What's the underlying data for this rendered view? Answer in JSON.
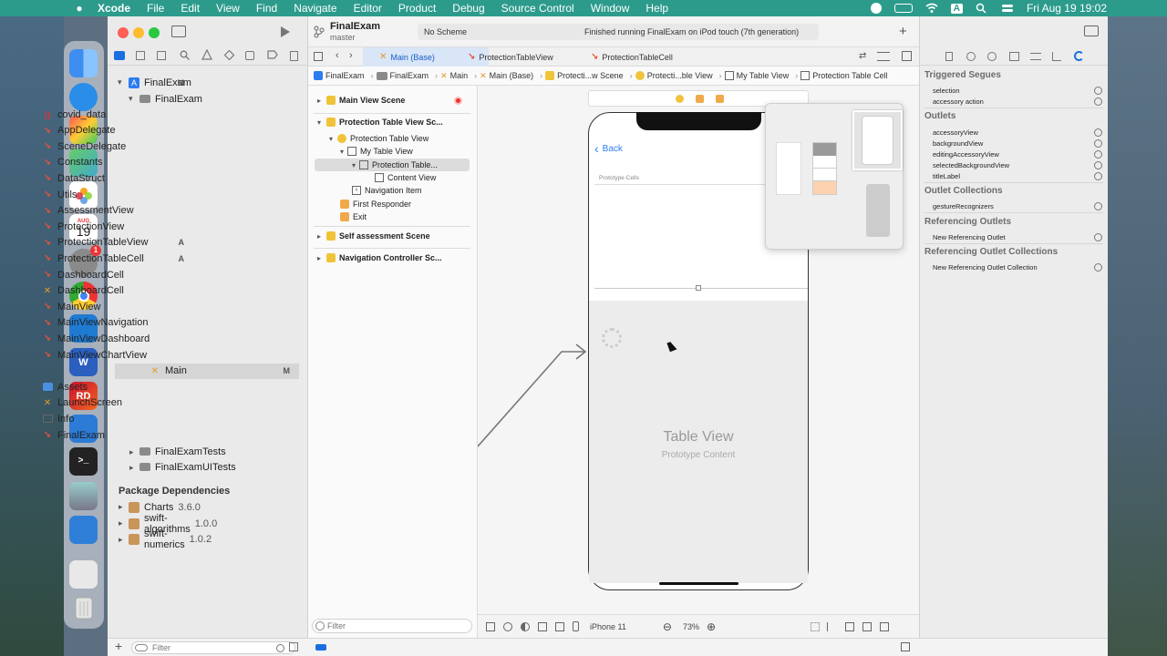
{
  "menubar": {
    "app": "Xcode",
    "items": [
      "File",
      "Edit",
      "View",
      "Find",
      "Navigate",
      "Editor",
      "Product",
      "Debug",
      "Source Control",
      "Window",
      "Help"
    ],
    "input_source": "A",
    "clock": "Fri Aug 19  19:02"
  },
  "dock": {
    "calendar_month": "AUG",
    "calendar_day": "19",
    "settings_badge": "1",
    "rider_label": "RD",
    "word_label": "W"
  },
  "toolbar": {
    "project": "FinalExam",
    "branch": "master",
    "scheme": "No Scheme",
    "status": "Finished running FinalExam on iPod touch (7th generation)",
    "add": "+"
  },
  "navigator": {
    "project_root": "FinalExam",
    "project_root_badge": "M",
    "group": "FinalExam",
    "files": [
      {
        "name": "covid_data",
        "kind": "json",
        "badge": ""
      },
      {
        "name": "AppDelegate",
        "kind": "swift",
        "badge": ""
      },
      {
        "name": "SceneDelegate",
        "kind": "swift",
        "badge": ""
      },
      {
        "name": "Constants",
        "kind": "swift",
        "badge": ""
      },
      {
        "name": "DataStruct",
        "kind": "swift",
        "badge": ""
      },
      {
        "name": "Utils",
        "kind": "swift",
        "badge": ""
      },
      {
        "name": "AssessmentView",
        "kind": "swift",
        "badge": ""
      },
      {
        "name": "ProtectionView",
        "kind": "swift",
        "badge": ""
      },
      {
        "name": "ProtectionTableView",
        "kind": "swift",
        "badge": "A"
      },
      {
        "name": "ProtectionTableCell",
        "kind": "swift",
        "badge": "A"
      },
      {
        "name": "DashboardCell",
        "kind": "swift",
        "badge": ""
      },
      {
        "name": "DashboardCell",
        "kind": "xib",
        "badge": ""
      },
      {
        "name": "MainView",
        "kind": "swift",
        "badge": ""
      },
      {
        "name": "MainViewNavigation",
        "kind": "swift",
        "badge": ""
      },
      {
        "name": "MainViewDashboard",
        "kind": "swift",
        "badge": ""
      },
      {
        "name": "MainViewChartView",
        "kind": "swift",
        "badge": ""
      },
      {
        "name": "Main",
        "kind": "storyboard",
        "badge": "M"
      },
      {
        "name": "Assets",
        "kind": "assets",
        "badge": ""
      },
      {
        "name": "LaunchScreen",
        "kind": "storyboard",
        "badge": ""
      },
      {
        "name": "Info",
        "kind": "plist",
        "badge": ""
      },
      {
        "name": "FinalExam",
        "kind": "swift",
        "badge": ""
      }
    ],
    "groups": [
      "FinalExamTests",
      "FinalExamUITests"
    ],
    "package_header": "Package Dependencies",
    "packages": [
      {
        "name": "Charts",
        "version": "3.6.0"
      },
      {
        "name": "swift-algorithms",
        "version": "1.0.0"
      },
      {
        "name": "swift-numerics",
        "version": "1.0.2"
      }
    ],
    "filter_placeholder": "Filter"
  },
  "tabs": [
    {
      "label": "Main (Base)"
    },
    {
      "label": "ProtectionTableView"
    },
    {
      "label": "ProtectionTableCell"
    }
  ],
  "jumpbar": [
    "FinalExam",
    "FinalExam",
    "Main",
    "Main (Base)",
    "Protecti...w Scene",
    "Protecti...ble View",
    "My Table View",
    "Protection Table Cell"
  ],
  "outline": {
    "main_scene": "Main View Scene",
    "protection_scene": "Protection Table View Sc...",
    "protection_controller": "Protection Table View",
    "my_table_view": "My Table View",
    "cell": "Protection Table...",
    "content_view": "Content View",
    "navigation_item": "Navigation Item",
    "first_responder": "First Responder",
    "exit": "Exit",
    "self_assessment": "Self assessment Scene",
    "nav_controller": "Navigation Controller Sc...",
    "filter_placeholder": "Filter"
  },
  "canvas": {
    "back": "Back",
    "prototype_cells": "Prototype Cells",
    "table_view_title": "Table View",
    "table_view_sub": "Prototype Content",
    "device": "iPhone 11",
    "zoom": "73%"
  },
  "inspector": {
    "triggered_segues": "Triggered Segues",
    "segues": [
      "selection",
      "accessory action"
    ],
    "outlets": "Outlets",
    "outlet_items": [
      "accessoryView",
      "backgroundView",
      "editingAccessoryView",
      "selectedBackgroundView",
      "titleLabel"
    ],
    "outlet_collections": "Outlet Collections",
    "collection_items": [
      "gestureRecognizers"
    ],
    "referencing_outlets": "Referencing Outlets",
    "referencing_items": [
      "New Referencing Outlet"
    ],
    "referencing_collections": "Referencing Outlet Collections",
    "referencing_collection_items": [
      "New Referencing Outlet Collection"
    ]
  }
}
